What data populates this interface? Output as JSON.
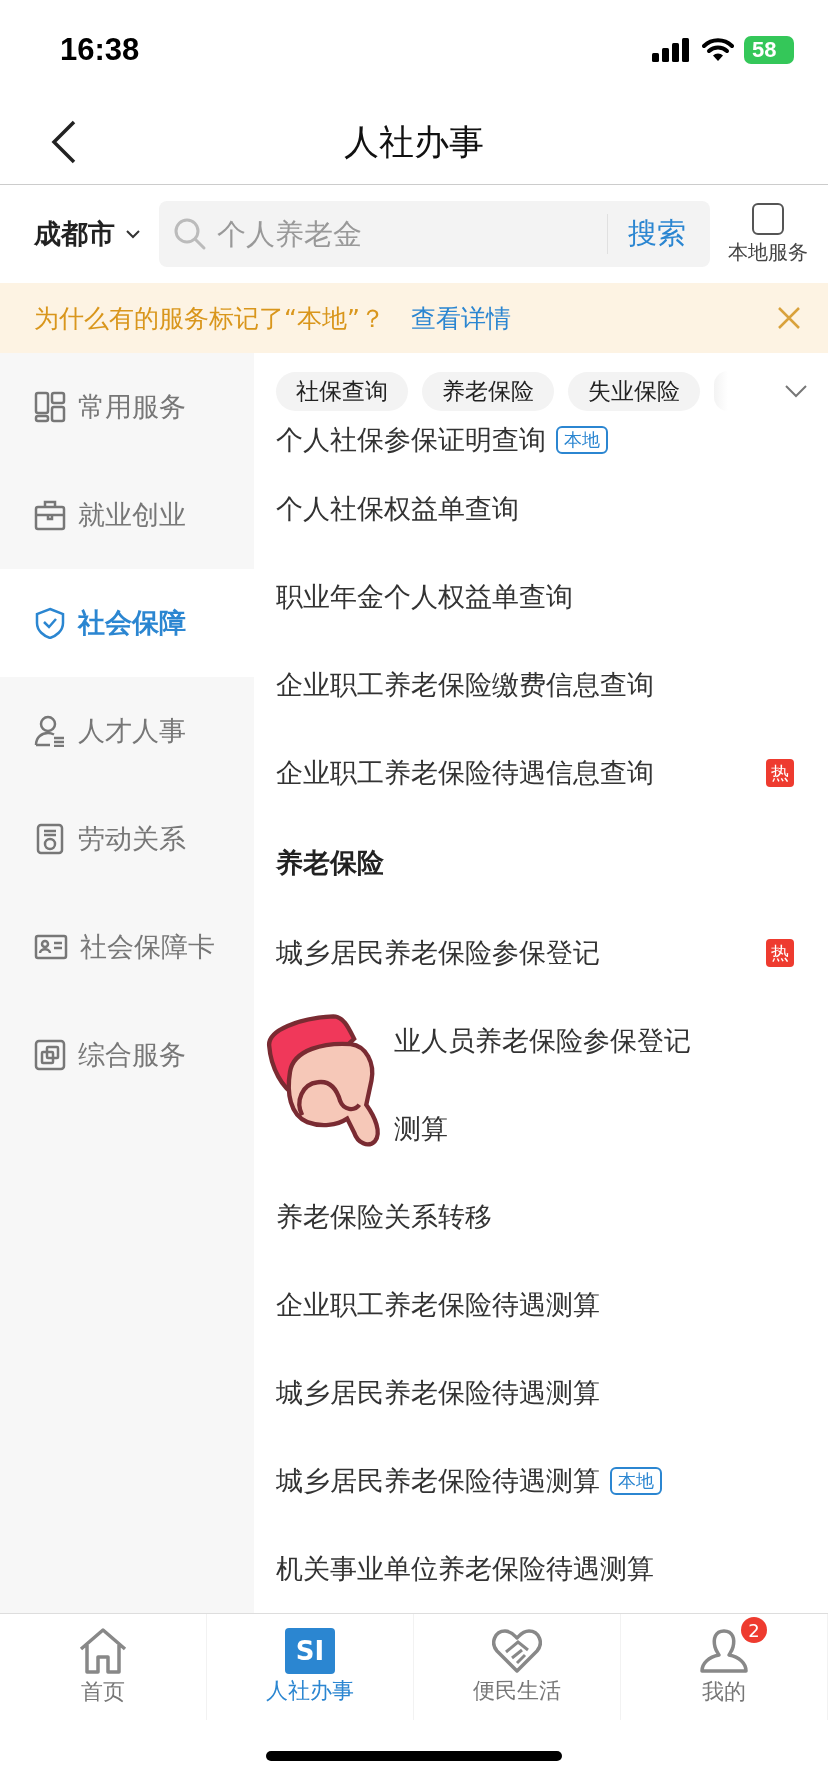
{
  "status_bar": {
    "time": "16:38",
    "battery": "58"
  },
  "nav": {
    "title": "人社办事"
  },
  "search": {
    "city": "成都市",
    "placeholder": "个人养老金",
    "button": "搜索",
    "local_toggle": {
      "label": "本地服务",
      "checked": false
    }
  },
  "notice": {
    "text": "为什么有的服务标记了“本地”？",
    "link": "查看详情"
  },
  "sidebar": {
    "items": [
      {
        "label": "常用服务",
        "selected": false
      },
      {
        "label": "就业创业",
        "selected": false
      },
      {
        "label": "社会保障",
        "selected": true
      },
      {
        "label": "人才人事",
        "selected": false
      },
      {
        "label": "劳动关系",
        "selected": false
      },
      {
        "label": "社会保障卡",
        "selected": false
      },
      {
        "label": "综合服务",
        "selected": false
      }
    ]
  },
  "chips": [
    {
      "label": "社保查询"
    },
    {
      "label": "养老保险"
    },
    {
      "label": "失业保险"
    }
  ],
  "list": [
    {
      "kind": "item",
      "text": "个人社保参保证明查询",
      "tag": {
        "kind": "local",
        "text": "本地"
      }
    },
    {
      "kind": "item",
      "text": "个人社保权益单查询"
    },
    {
      "kind": "item",
      "text": "职业年金个人权益单查询"
    },
    {
      "kind": "item",
      "text": "企业职工养老保险缴费信息查询"
    },
    {
      "kind": "item",
      "text": "企业职工养老保险待遇信息查询",
      "tag": {
        "kind": "hot",
        "text": "热"
      }
    },
    {
      "kind": "header",
      "text": "养老保险"
    },
    {
      "kind": "item",
      "text": "城乡居民养老保险参保登记",
      "tag": {
        "kind": "hot",
        "text": "热"
      }
    },
    {
      "kind": "covered",
      "text": "业人员养老保险参保登记"
    },
    {
      "kind": "covered",
      "text": "测算"
    },
    {
      "kind": "item",
      "text": "养老保险关系转移"
    },
    {
      "kind": "item",
      "text": "企业职工养老保险待遇测算"
    },
    {
      "kind": "item",
      "text": "城乡居民养老保险待遇测算"
    },
    {
      "kind": "item",
      "text": "城乡居民养老保险待遇测算",
      "tag": {
        "kind": "local",
        "text": "本地"
      }
    },
    {
      "kind": "item",
      "text": "机关事业单位养老保险待遇测算"
    }
  ],
  "tabbar": [
    {
      "label": "首页",
      "selected": false
    },
    {
      "label": "人社办事",
      "selected": true,
      "logo_text": "SI"
    },
    {
      "label": "便民生活",
      "selected": false
    },
    {
      "label": "我的",
      "selected": false,
      "badge": "2"
    }
  ]
}
